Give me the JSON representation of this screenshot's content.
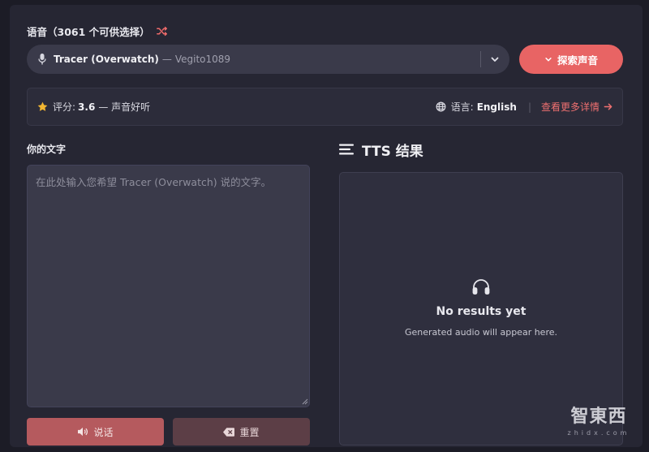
{
  "voice": {
    "heading": "语音（3061 个可供选择）",
    "selected_name": "Tracer (Overwatch)",
    "separator": "—",
    "selected_author": "Vegito1089"
  },
  "explore_button_label": "探索声音",
  "info": {
    "rating_label": "评分:",
    "rating_value": "3.6",
    "rating_desc": "— 声音好听",
    "language_label": "语言:",
    "language_value": "English",
    "pipe": "|",
    "details_link": "查看更多详情"
  },
  "input": {
    "label": "你的文字",
    "placeholder": "在此处输入您希望 Tracer (Overwatch) 说的文字。"
  },
  "actions": {
    "speak_label": "说话",
    "reset_label": "重置"
  },
  "results": {
    "title": "TTS 结果",
    "empty_title": "No results yet",
    "empty_subtitle": "Generated audio will appear here."
  },
  "watermark": {
    "text": "智東西",
    "sub": "zhidx.com"
  },
  "colors": {
    "accent": "#e86464",
    "link": "#ef7070",
    "star": "#f2b632",
    "background": "#1c1c26",
    "panel": "#262633"
  },
  "icons": [
    "shuffle-icon",
    "microphone-icon",
    "chevron-down-icon",
    "star-icon",
    "globe-icon",
    "arrow-right-icon",
    "speaker-icon",
    "backspace-icon",
    "menu-icon",
    "headphones-icon"
  ]
}
